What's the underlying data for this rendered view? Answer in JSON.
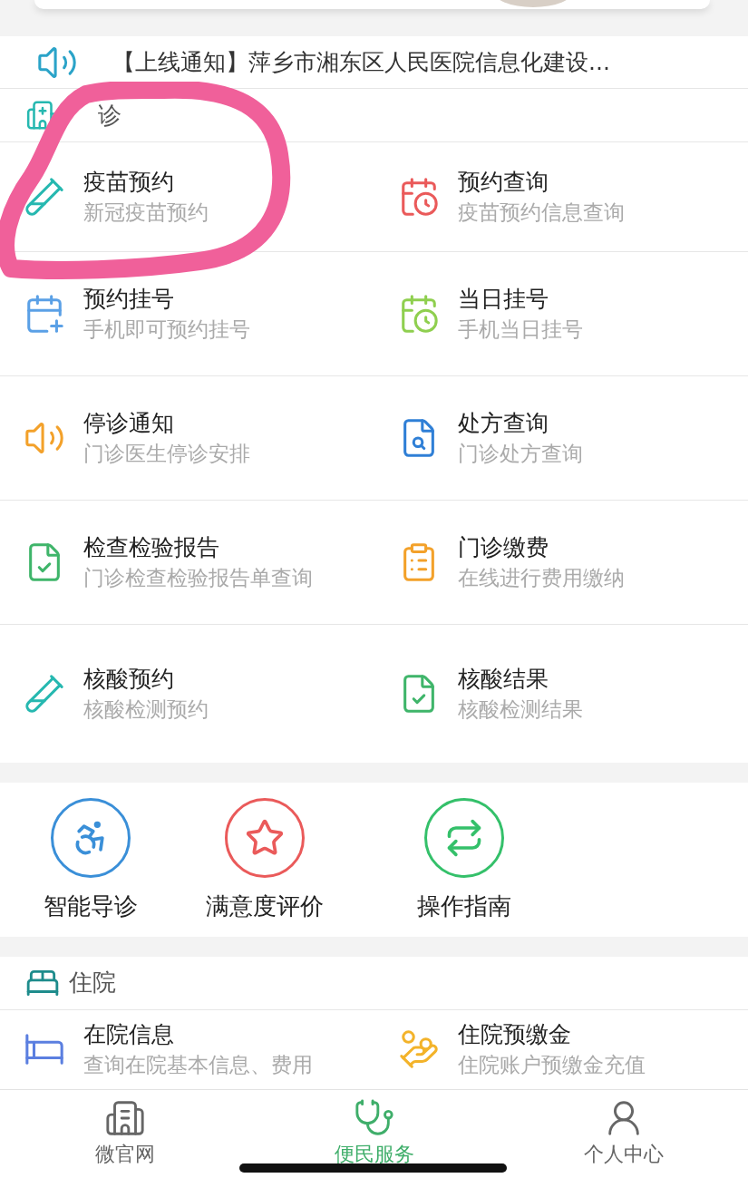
{
  "notice": {
    "text": "【上线通知】萍乡市湘东区人民医院信息化建设..."
  },
  "outpatient": {
    "title": "诊",
    "items": [
      {
        "title": "疫苗预约",
        "subtitle": "新冠疫苗预约"
      },
      {
        "title": "预约查询",
        "subtitle": "疫苗预约信息查询"
      },
      {
        "title": "预约挂号",
        "subtitle": "手机即可预约挂号"
      },
      {
        "title": "当日挂号",
        "subtitle": "手机当日挂号"
      },
      {
        "title": "停诊通知",
        "subtitle": "门诊医生停诊安排"
      },
      {
        "title": "处方查询",
        "subtitle": "门诊处方查询"
      },
      {
        "title": "检查检验报告",
        "subtitle": "门诊检查检验报告单查询"
      },
      {
        "title": "门诊缴费",
        "subtitle": "在线进行费用缴纳"
      },
      {
        "title": "核酸预约",
        "subtitle": "核酸检测预约"
      },
      {
        "title": "核酸结果",
        "subtitle": "核酸检测结果"
      }
    ]
  },
  "shortcuts": [
    {
      "label": "智能导诊"
    },
    {
      "label": "满意度评价"
    },
    {
      "label": "操作指南"
    }
  ],
  "inpatient": {
    "title": "住院",
    "items": [
      {
        "title": "在院信息",
        "subtitle": "查询在院基本信息、费用"
      },
      {
        "title": "住院预缴金",
        "subtitle": "住院账户预缴金充值"
      }
    ]
  },
  "tab_bar": [
    {
      "label": "微官网",
      "selected": false
    },
    {
      "label": "便民服务",
      "selected": true
    },
    {
      "label": "个人中心",
      "selected": false
    }
  ]
}
